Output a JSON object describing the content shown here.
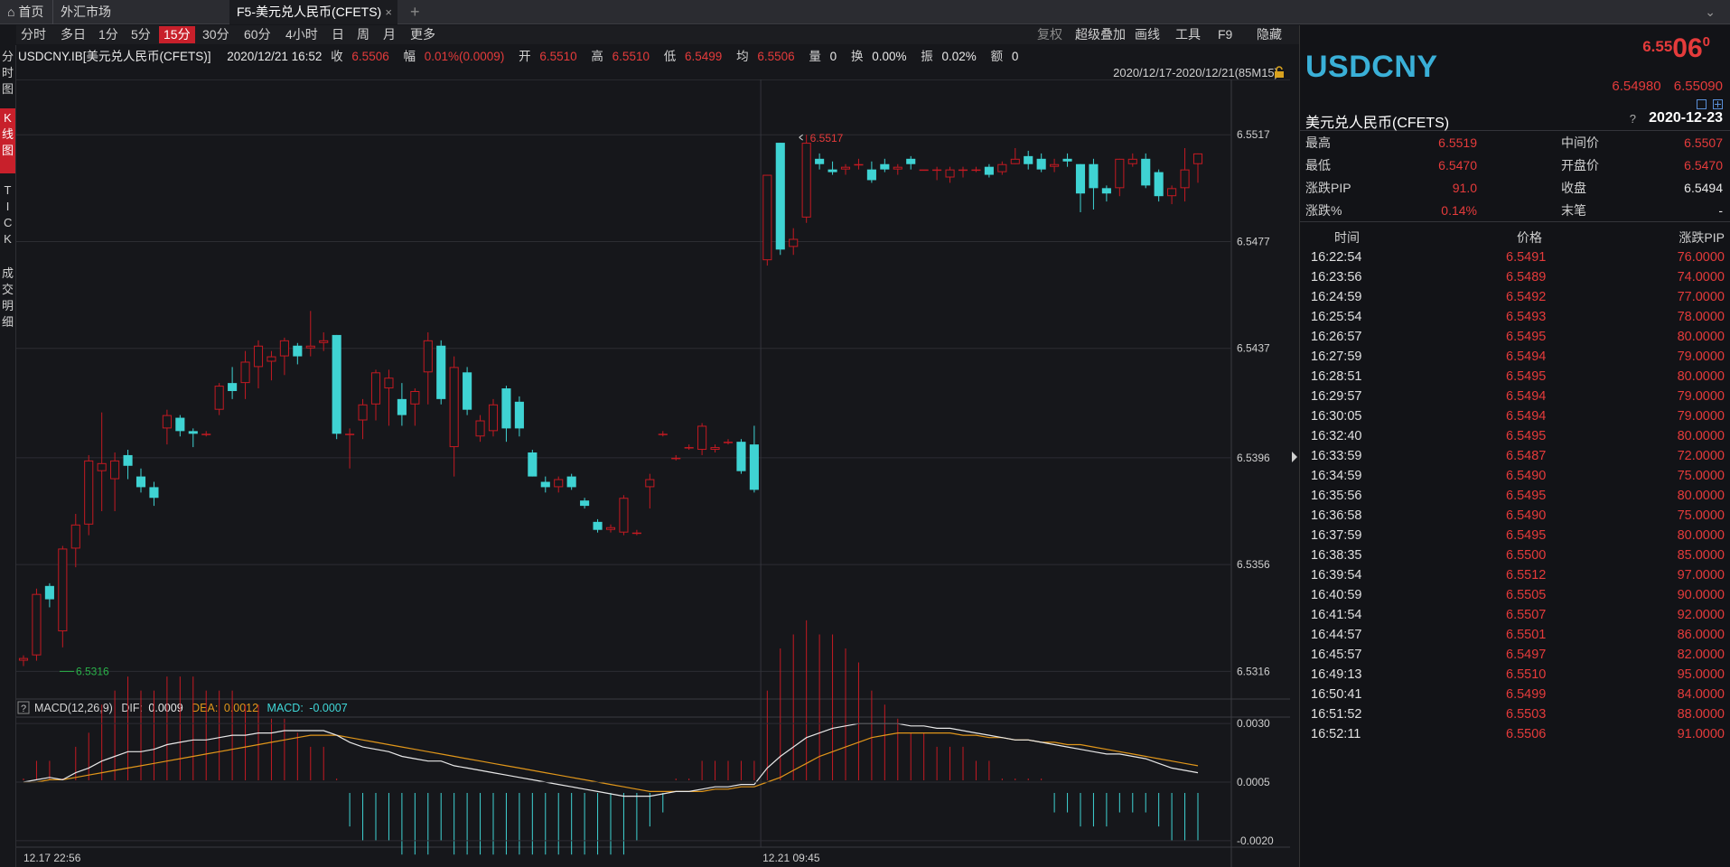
{
  "tabs": {
    "home": "首页",
    "market": "外汇市场",
    "active": "F5-美元兑人民币(CFETS)",
    "close": "×",
    "add": "+",
    "collapse": "⌄"
  },
  "periods": [
    "分时",
    "多日",
    "1分",
    "5分",
    "15分",
    "30分",
    "60分",
    "4小时",
    "日",
    "周",
    "月",
    "更多"
  ],
  "active_period": "15分",
  "right_tools": {
    "fuquan": "复权",
    "overlay": "超级叠加",
    "draw": "画线",
    "tools": "工具",
    "f9": "F9",
    "hide": "隐藏"
  },
  "left_nav": {
    "fenshi": "分时图",
    "kline": "K线图",
    "tick": "TICK",
    "deals": "成交明细"
  },
  "info": {
    "symbol": "USDCNY.IB[美元兑人民币(CFETS)]",
    "datetime": "2020/12/21 16:52",
    "close_label": "收",
    "close": "6.5506",
    "change_label": "幅",
    "change": "0.01%(0.0009)",
    "open_label": "开",
    "open": "6.5510",
    "high_label": "高",
    "high": "6.5510",
    "low_label": "低",
    "low": "6.5499",
    "avg_label": "均",
    "avg": "6.5506",
    "vol_label": "量",
    "vol": "0",
    "turnover_label": "换",
    "turnover": "0.00%",
    "amp_label": "振",
    "amp": "0.02%",
    "amount_label": "额",
    "amount": "0"
  },
  "date_range": "2020/12/17-2020/12/21(85M15)",
  "chart_data": {
    "type": "candlestick",
    "price_axis": {
      "ticks": [
        "6.5517",
        "6.5477",
        "6.5437",
        "6.5396",
        "6.5356",
        "6.5316"
      ],
      "ylim": [
        6.5307,
        6.5535
      ]
    },
    "x_labels": [
      "12.17 22:56",
      "12.21 09:45"
    ],
    "max_marker": "6.5517",
    "min_marker": "6.5316",
    "candles": [
      [
        6.532,
        6.5321,
        6.5318,
        6.5322
      ],
      [
        6.5322,
        6.5345,
        6.532,
        6.5347
      ],
      [
        6.5348,
        6.5343,
        6.534,
        6.5349
      ],
      [
        6.5331,
        6.5362,
        6.5325,
        6.5363
      ],
      [
        6.5362,
        6.5371,
        6.5355,
        6.5375
      ],
      [
        6.5371,
        6.5395,
        6.5367,
        6.5397
      ],
      [
        6.5391,
        6.5394,
        6.5376,
        6.5413
      ],
      [
        6.5388,
        6.5395,
        6.5376,
        6.5398
      ],
      [
        6.5397,
        6.5393,
        6.5388,
        6.5399
      ],
      [
        6.5389,
        6.5385,
        6.5383,
        6.5392
      ],
      [
        6.5385,
        6.5381,
        6.5378,
        6.5387
      ],
      [
        6.5407,
        6.5412,
        6.5401,
        6.5414
      ],
      [
        6.5411,
        6.5406,
        6.5404,
        6.5412
      ],
      [
        6.5406,
        6.5405,
        6.54,
        6.5407
      ],
      [
        6.5405,
        6.5405,
        6.5404,
        6.5406
      ],
      [
        6.5414,
        6.5423,
        6.5412,
        6.5424
      ],
      [
        6.5424,
        6.5421,
        6.5418,
        6.543
      ],
      [
        6.5424,
        6.5432,
        6.5418,
        6.5436
      ],
      [
        6.543,
        6.5438,
        6.5422,
        6.544
      ],
      [
        6.5432,
        6.5434,
        6.5425,
        6.5436
      ],
      [
        6.5434,
        6.544,
        6.5427,
        6.5441
      ],
      [
        6.5438,
        6.5434,
        6.5431,
        6.5439
      ],
      [
        6.5437,
        6.5438,
        6.5434,
        6.5451
      ],
      [
        6.5439,
        6.544,
        6.5436,
        6.5443
      ],
      [
        6.5442,
        6.5405,
        6.5403,
        6.5442
      ],
      [
        6.5405,
        6.5405,
        6.5392,
        6.5407
      ],
      [
        6.541,
        6.5416,
        6.5403,
        6.5418
      ],
      [
        6.5416,
        6.5428,
        6.541,
        6.5429
      ],
      [
        6.5422,
        6.5426,
        6.5408,
        6.5429
      ],
      [
        6.5418,
        6.5412,
        6.5408,
        6.5424
      ],
      [
        6.5416,
        6.5421,
        6.5408,
        6.5422
      ],
      [
        6.5428,
        6.544,
        6.5416,
        6.5443
      ],
      [
        6.5438,
        6.5418,
        6.5416,
        6.544
      ],
      [
        6.54,
        6.543,
        6.5389,
        6.5434
      ],
      [
        6.5428,
        6.5414,
        6.5412,
        6.543
      ],
      [
        6.5404,
        6.541,
        6.5402,
        6.5412
      ],
      [
        6.5406,
        6.5416,
        6.5404,
        6.5418
      ],
      [
        6.5422,
        6.5407,
        6.5402,
        6.5423
      ],
      [
        6.5417,
        6.5407,
        6.5404,
        6.5419
      ],
      [
        6.5398,
        6.5389,
        6.5389,
        6.5399
      ],
      [
        6.5387,
        6.5385,
        6.5383,
        6.5389
      ],
      [
        6.5385,
        6.5388,
        6.5383,
        6.5389
      ],
      [
        6.5389,
        6.5385,
        6.5384,
        6.539
      ],
      [
        6.538,
        6.5378,
        6.5377,
        6.5381
      ],
      [
        6.5372,
        6.5369,
        6.5368,
        6.5373
      ],
      [
        6.5369,
        6.537,
        6.5368,
        6.5371
      ],
      [
        6.5368,
        6.5381,
        6.5367,
        6.5382
      ],
      [
        6.5368,
        6.5368,
        6.5367,
        6.5369
      ],
      [
        6.5385,
        6.5388,
        6.5377,
        6.539
      ],
      [
        6.5405,
        6.5405,
        6.5404,
        6.5406
      ],
      [
        6.5396,
        6.5396,
        6.5395,
        6.5397
      ],
      [
        6.54,
        6.54,
        6.5399,
        6.5401
      ],
      [
        6.5399,
        6.5408,
        6.5397,
        6.5409
      ],
      [
        6.5399,
        6.54,
        6.5398,
        6.5401
      ],
      [
        6.5402,
        6.5402,
        6.5401,
        6.5403
      ],
      [
        6.5402,
        6.5391,
        6.539,
        6.5403
      ],
      [
        6.5401,
        6.5384,
        6.5383,
        6.5408
      ],
      [
        6.547,
        6.5502,
        6.5468,
        6.5502
      ],
      [
        6.5514,
        6.5474,
        6.5472,
        6.5514
      ],
      [
        6.5475,
        6.5478,
        6.5472,
        6.5482
      ],
      [
        6.5486,
        6.5514,
        6.5484,
        6.5517
      ],
      [
        6.5508,
        6.5506,
        6.5504,
        6.551
      ],
      [
        6.5504,
        6.5503,
        6.5502,
        6.5507
      ],
      [
        6.5504,
        6.5505,
        6.5502,
        6.5506
      ],
      [
        6.5506,
        6.5506,
        6.5504,
        6.5508
      ],
      [
        6.5504,
        6.55,
        6.5499,
        6.5507
      ],
      [
        6.5506,
        6.5504,
        6.5503,
        6.5508
      ],
      [
        6.5504,
        6.5505,
        6.5502,
        6.5506
      ],
      [
        6.5508,
        6.5506,
        6.5504,
        6.5509
      ],
      [
        6.5504,
        6.5504,
        6.5504,
        6.5504
      ],
      [
        6.5504,
        6.5504,
        6.55,
        6.5505
      ],
      [
        6.5501,
        6.5504,
        6.5499,
        6.5505
      ],
      [
        6.5504,
        6.5504,
        6.5501,
        6.5505
      ],
      [
        6.5504,
        6.5504,
        6.5503,
        6.5505
      ],
      [
        6.5505,
        6.5502,
        6.5501,
        6.5506
      ],
      [
        6.5503,
        6.5506,
        6.5502,
        6.5507
      ],
      [
        6.5506,
        6.5508,
        6.5506,
        6.5512
      ],
      [
        6.5509,
        6.5506,
        6.5504,
        6.5511
      ],
      [
        6.5508,
        6.5504,
        6.5503,
        6.551
      ],
      [
        6.5505,
        6.5506,
        6.5503,
        6.5508
      ],
      [
        6.5508,
        6.5507,
        6.5505,
        6.551
      ],
      [
        6.5506,
        6.5495,
        6.5488,
        6.5506
      ],
      [
        6.5506,
        6.5497,
        6.5489,
        6.5508
      ],
      [
        6.5497,
        6.5495,
        6.5492,
        6.5498
      ],
      [
        6.5497,
        6.5508,
        6.5494,
        6.5508
      ],
      [
        6.5506,
        6.5508,
        6.5505,
        6.551
      ],
      [
        6.5508,
        6.5498,
        6.5497,
        6.551
      ],
      [
        6.5503,
        6.5494,
        6.5492,
        6.5504
      ],
      [
        6.5494,
        6.5497,
        6.5491,
        6.5498
      ],
      [
        6.5497,
        6.5504,
        6.5492,
        6.5512
      ],
      [
        6.5506,
        6.551,
        6.5499,
        6.551
      ]
    ],
    "macd": {
      "title": "MACD(12,26,9)",
      "dif_label": "DIF:",
      "dif": "0.0009",
      "dea_label": "DEA:",
      "dea": "0.0012",
      "macd_label": "MACD:",
      "macd": "-0.0007",
      "ylim": [
        -0.0022,
        0.0032
      ],
      "ticks": [
        "0.0030",
        "0.0005",
        "-0.0020"
      ],
      "dif_series": [
        0.0005,
        0.0006,
        0.0007,
        0.0006,
        0.0009,
        0.0011,
        0.0014,
        0.0016,
        0.0018,
        0.0018,
        0.0019,
        0.0021,
        0.0022,
        0.0023,
        0.0023,
        0.0024,
        0.0025,
        0.0025,
        0.0026,
        0.0026,
        0.0027,
        0.0027,
        0.0027,
        0.0027,
        0.0025,
        0.0022,
        0.002,
        0.0019,
        0.0018,
        0.0016,
        0.0015,
        0.0014,
        0.0014,
        0.0012,
        0.0011,
        0.001,
        0.0009,
        0.0008,
        0.0007,
        0.0006,
        0.0005,
        0.0004,
        0.0003,
        0.0002,
        0.0001,
        0.0,
        -0.0001,
        -0.0001,
        -0.0001,
        0.0,
        0.0001,
        0.0001,
        0.0002,
        0.0003,
        0.0003,
        0.0004,
        0.0004,
        0.0011,
        0.0016,
        0.002,
        0.0024,
        0.0026,
        0.0028,
        0.0029,
        0.003,
        0.003,
        0.003,
        0.003,
        0.0029,
        0.0029,
        0.0028,
        0.0028,
        0.0027,
        0.0026,
        0.0025,
        0.0024,
        0.0023,
        0.0023,
        0.0022,
        0.0021,
        0.002,
        0.0019,
        0.0018,
        0.0017,
        0.0017,
        0.0016,
        0.0015,
        0.0013,
        0.0011,
        0.001,
        0.0009
      ],
      "dea_series": [
        0.0005,
        0.0005,
        0.0006,
        0.0006,
        0.0007,
        0.0008,
        0.0009,
        0.001,
        0.0011,
        0.0012,
        0.0013,
        0.0014,
        0.0015,
        0.0016,
        0.0017,
        0.0018,
        0.0019,
        0.002,
        0.0021,
        0.0022,
        0.0023,
        0.0024,
        0.0025,
        0.0025,
        0.0025,
        0.0024,
        0.0023,
        0.0022,
        0.0021,
        0.002,
        0.0019,
        0.0018,
        0.0017,
        0.0016,
        0.0015,
        0.0014,
        0.0013,
        0.0012,
        0.0011,
        0.001,
        0.0009,
        0.0008,
        0.0007,
        0.0006,
        0.0005,
        0.0004,
        0.0003,
        0.0002,
        0.0001,
        0.0001,
        0.0001,
        0.0001,
        0.0001,
        0.0002,
        0.0002,
        0.0003,
        0.0003,
        0.0005,
        0.0007,
        0.001,
        0.0013,
        0.0016,
        0.0018,
        0.002,
        0.0022,
        0.0024,
        0.0025,
        0.0026,
        0.0026,
        0.0026,
        0.0026,
        0.0026,
        0.0025,
        0.0025,
        0.0024,
        0.0024,
        0.0023,
        0.0023,
        0.0022,
        0.0022,
        0.0021,
        0.0021,
        0.002,
        0.0019,
        0.0018,
        0.0017,
        0.0016,
        0.0015,
        0.0014,
        0.0013,
        0.0012
      ]
    }
  },
  "quote": {
    "symbol": "USDCNY",
    "price_small": "6.55",
    "price_large": "06",
    "price_sup": "0",
    "bid": "6.54980",
    "ask": "6.55090",
    "name": "美元兑人民币(CFETS)",
    "question": "?",
    "date": "2020-12-23",
    "stats": [
      {
        "l1": "最高",
        "v1": "6.5519",
        "l2": "中间价",
        "v2": "6.5507",
        "v2white": false
      },
      {
        "l1": "最低",
        "v1": "6.5470",
        "l2": "开盘价",
        "v2": "6.5470",
        "v2white": false
      },
      {
        "l1": "涨跌PIP",
        "v1": "91.0",
        "l2": "收盘",
        "v2": "6.5494",
        "v2white": true
      },
      {
        "l1": "涨跌%",
        "v1": "0.14%",
        "l2": "末笔",
        "v2": "-",
        "v2white": true
      }
    ]
  },
  "ticks": {
    "header": {
      "time": "时间",
      "price": "价格",
      "pip": "涨跌PIP"
    },
    "rows": [
      [
        "16:22:54",
        "6.5491",
        "76.0000"
      ],
      [
        "16:23:56",
        "6.5489",
        "74.0000"
      ],
      [
        "16:24:59",
        "6.5492",
        "77.0000"
      ],
      [
        "16:25:54",
        "6.5493",
        "78.0000"
      ],
      [
        "16:26:57",
        "6.5495",
        "80.0000"
      ],
      [
        "16:27:59",
        "6.5494",
        "79.0000"
      ],
      [
        "16:28:51",
        "6.5495",
        "80.0000"
      ],
      [
        "16:29:57",
        "6.5494",
        "79.0000"
      ],
      [
        "16:30:05",
        "6.5494",
        "79.0000"
      ],
      [
        "16:32:40",
        "6.5495",
        "80.0000"
      ],
      [
        "16:33:59",
        "6.5487",
        "72.0000"
      ],
      [
        "16:34:59",
        "6.5490",
        "75.0000"
      ],
      [
        "16:35:56",
        "6.5495",
        "80.0000"
      ],
      [
        "16:36:58",
        "6.5490",
        "75.0000"
      ],
      [
        "16:37:59",
        "6.5495",
        "80.0000"
      ],
      [
        "16:38:35",
        "6.5500",
        "85.0000"
      ],
      [
        "16:39:54",
        "6.5512",
        "97.0000"
      ],
      [
        "16:40:59",
        "6.5505",
        "90.0000"
      ],
      [
        "16:41:54",
        "6.5507",
        "92.0000"
      ],
      [
        "16:44:57",
        "6.5501",
        "86.0000"
      ],
      [
        "16:45:57",
        "6.5497",
        "82.0000"
      ],
      [
        "16:49:13",
        "6.5510",
        "95.0000"
      ],
      [
        "16:50:41",
        "6.5499",
        "84.0000"
      ],
      [
        "16:51:52",
        "6.5503",
        "88.0000"
      ],
      [
        "16:52:11",
        "6.5506",
        "91.0000"
      ]
    ]
  },
  "colors": {
    "up": "#c41a22",
    "down": "#3fd3d3",
    "dif": "#e8e8e8",
    "dea": "#e0961a",
    "accent": "#c8202b",
    "symbol": "#3ab0d8"
  },
  "icons": [
    "home-icon",
    "lock-icon",
    "collapse-arrow-icon",
    "close-icon"
  ]
}
